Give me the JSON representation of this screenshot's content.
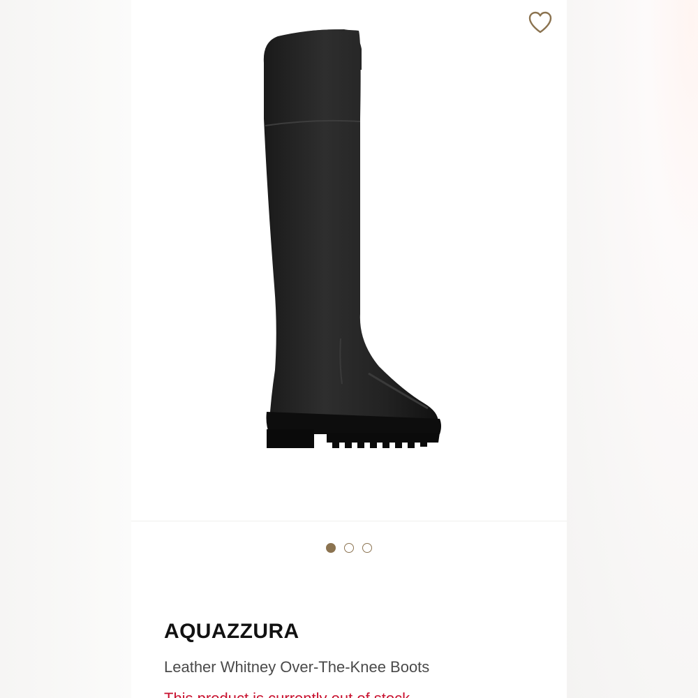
{
  "product": {
    "brand": "AQUAZZURA",
    "name": "Leather Whitney Over-The-Knee Boots",
    "stock_note": "This product is currently out of stock",
    "image_icon": "boot-product-image"
  },
  "gallery": {
    "image_count": 3,
    "active_index": 0
  },
  "wishlist": {
    "icon": "heart-icon"
  },
  "colors": {
    "accent": "#8b7350",
    "alert": "#c8102e",
    "text": "#111111"
  }
}
